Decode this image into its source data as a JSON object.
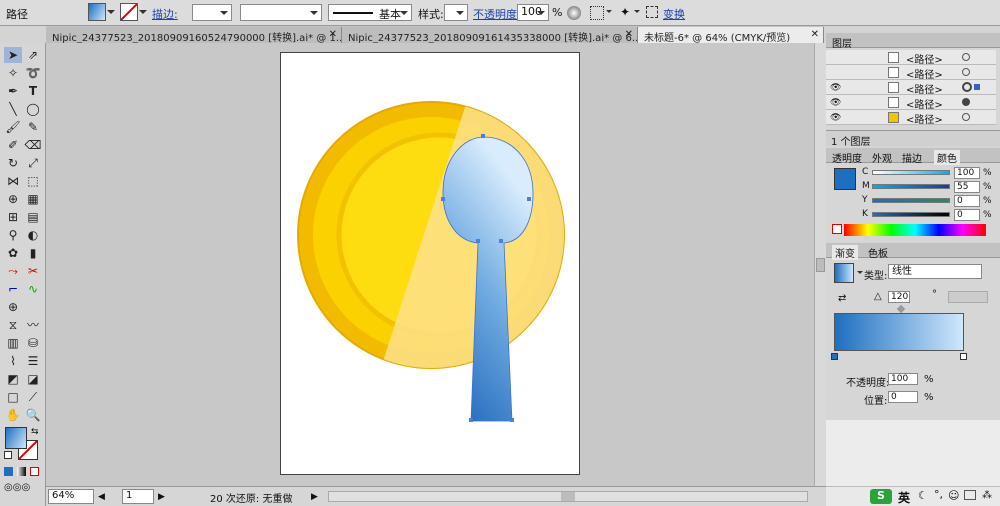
{
  "control_bar": {
    "object_type": "路径",
    "stroke_label": "描边:",
    "stroke_profile": "基本",
    "style_label": "样式:",
    "opacity_label": "不透明度:",
    "opacity_value": "100",
    "opacity_unit": "%",
    "transform_link": "变换"
  },
  "tabs": [
    {
      "label": "Nipic_24377523_20180909160524790000  [转换].ai* @ 1..."
    },
    {
      "label": "Nipic_24377523_20180909161435338000  [转换].ai* @ 6..."
    },
    {
      "label": "未标题-6* @ 64% (CMYK/预览)"
    }
  ],
  "tab_close": "✕",
  "status": {
    "zoom": "64%",
    "page": "1",
    "history": "20 次还原: 无重做"
  },
  "layers_panel": {
    "title": "图层",
    "count": "1 个图层",
    "items": [
      {
        "name": "<路径>"
      },
      {
        "name": "<路径>"
      },
      {
        "name": "<路径>"
      },
      {
        "name": "<路径>"
      },
      {
        "name": "<路径>"
      }
    ]
  },
  "color_panel": {
    "tabs": [
      "透明度",
      "外观",
      "描边",
      "颜色"
    ],
    "channels": [
      {
        "label": "C",
        "value": "100"
      },
      {
        "label": "M",
        "value": "55"
      },
      {
        "label": "Y",
        "value": "0"
      },
      {
        "label": "K",
        "value": "0"
      }
    ],
    "unit": "%"
  },
  "gradient_panel": {
    "tabs": [
      "渐变",
      "色板"
    ],
    "type_label": "类型:",
    "type_value": "线性",
    "angle": "120",
    "angle_unit": "°",
    "opacity_label": "不透明度:",
    "opacity_value": "100",
    "location_label": "位置:",
    "location_value": "0",
    "unit": "%"
  },
  "taskbar": {
    "ime": "英"
  },
  "colors": {
    "gold": "#f5c400",
    "spoon_dark": "#1e6fc1",
    "spoon_light": "#cfe7fb"
  }
}
